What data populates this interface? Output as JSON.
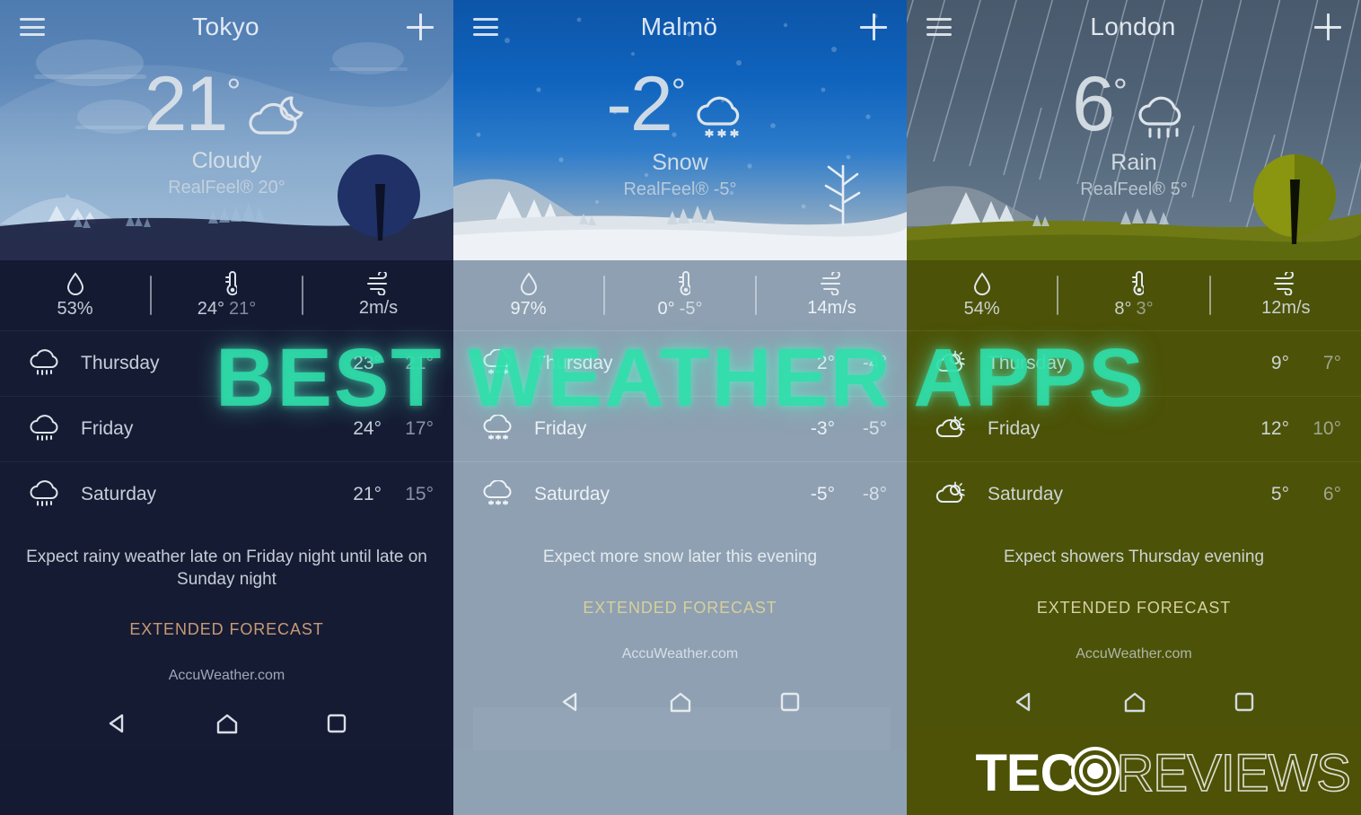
{
  "overlay": {
    "banner_text": "BEST WEATHER APPS",
    "banner_color": "#2ddeaa",
    "watermark_tec": "TEC",
    "watermark_reviews": "REVIEWS",
    "watermark_icon": "target-bullseye-icon"
  },
  "panels": [
    {
      "id": "tokyo",
      "menu_icon": "hamburger-menu-icon",
      "city": "Tokyo",
      "add_icon": "plus-icon",
      "temperature": "21",
      "degree": "°",
      "condition": "Cloudy",
      "condition_icon": "cloudy-night-icon",
      "realfeel": "RealFeel® 20°",
      "stats": {
        "humidity_icon": "water-drop-icon",
        "humidity": "53%",
        "temp_icon": "thermometer-icon",
        "temp_high": "24°",
        "temp_low": "21°",
        "wind_icon": "wind-icon",
        "wind": "2m/s"
      },
      "forecast": [
        {
          "icon": "rain-cloud-icon",
          "day": "Thursday",
          "hi": "23°",
          "lo": "21°"
        },
        {
          "icon": "rain-cloud-icon",
          "day": "Friday",
          "hi": "24°",
          "lo": "17°"
        },
        {
          "icon": "rain-cloud-icon",
          "day": "Saturday",
          "hi": "21°",
          "lo": "15°"
        }
      ],
      "summary": "Expect rainy weather late on Friday night until late on Sunday night",
      "extended": "EXTENDED FORECAST",
      "extended_color": "#c79b74",
      "provider": "AccuWeather.com",
      "nav": {
        "back_icon": "back-triangle-icon",
        "home_icon": "home-icon",
        "recents_icon": "recents-square-icon"
      }
    },
    {
      "id": "malmo",
      "menu_icon": "hamburger-menu-icon",
      "city": "Malmö",
      "add_icon": "plus-icon",
      "temperature": "-2",
      "degree": "°",
      "condition": "Snow",
      "condition_icon": "snow-cloud-icon",
      "realfeel": "RealFeel® -5°",
      "stats": {
        "humidity_icon": "water-drop-icon",
        "humidity": "97%",
        "temp_icon": "thermometer-icon",
        "temp_high": "0°",
        "temp_low": "-5°",
        "wind_icon": "wind-icon",
        "wind": "14m/s"
      },
      "forecast": [
        {
          "icon": "snow-cloud-icon",
          "day": "Thursday",
          "hi": "2°",
          "lo": "-4°"
        },
        {
          "icon": "snow-cloud-icon",
          "day": "Friday",
          "hi": "-3°",
          "lo": "-5°"
        },
        {
          "icon": "snow-cloud-icon",
          "day": "Saturday",
          "hi": "-5°",
          "lo": "-8°"
        }
      ],
      "summary": "Expect more snow later this evening",
      "extended": "EXTENDED FORECAST",
      "extended_color": "#d8cf9a",
      "provider": "AccuWeather.com",
      "nav": {
        "back_icon": "back-triangle-icon",
        "home_icon": "home-icon",
        "recents_icon": "recents-square-icon"
      }
    },
    {
      "id": "london",
      "menu_icon": "hamburger-menu-icon",
      "city": "London",
      "add_icon": "plus-icon",
      "temperature": "6",
      "degree": "°",
      "condition": "Rain",
      "condition_icon": "rain-cloud-icon",
      "realfeel": "RealFeel® 5°",
      "stats": {
        "humidity_icon": "water-drop-icon",
        "humidity": "54%",
        "temp_icon": "thermometer-icon",
        "temp_high": "8°",
        "temp_low": "3°",
        "wind_icon": "wind-icon",
        "wind": "12m/s"
      },
      "forecast": [
        {
          "icon": "partly-sunny-icon",
          "day": "Thursday",
          "hi": "9°",
          "lo": "7°"
        },
        {
          "icon": "partly-sunny-icon",
          "day": "Friday",
          "hi": "12°",
          "lo": "10°"
        },
        {
          "icon": "partly-sunny-icon",
          "day": "Saturday",
          "hi": "5°",
          "lo": "6°"
        }
      ],
      "summary": "Expect showers Thursday evening",
      "extended": "EXTENDED FORECAST",
      "extended_color": "#d6d2a4",
      "provider": "AccuWeather.com",
      "nav": {
        "back_icon": "back-triangle-icon",
        "home_icon": "home-icon",
        "recents_icon": "recents-square-icon"
      }
    }
  ]
}
